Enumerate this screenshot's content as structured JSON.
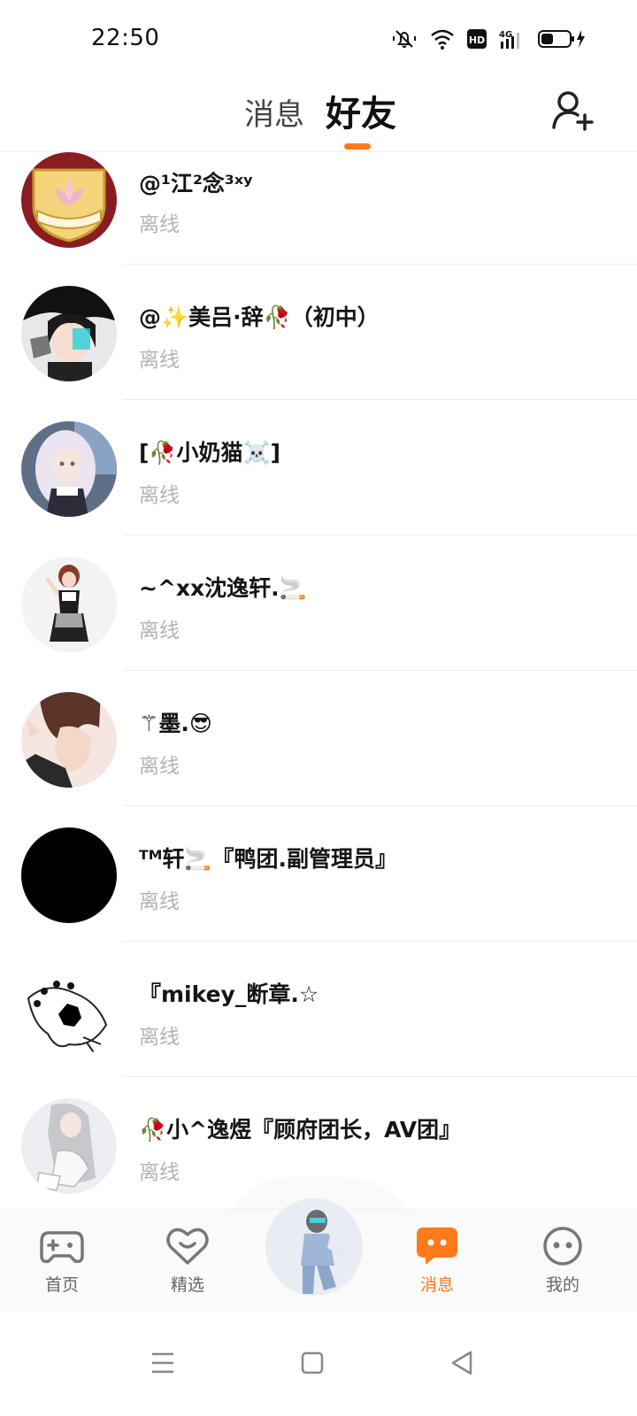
{
  "status_bar": {
    "time": "22:50",
    "hd_label": "HD",
    "network_label": "4G"
  },
  "header": {
    "tab_messages": "消息",
    "tab_friends": "好友",
    "active_tab": "好友"
  },
  "friends": [
    {
      "name": "@¹江²念³ˣʸ",
      "status": "离线"
    },
    {
      "name": "@✨美吕·辞🥀（初中）",
      "status": "离线"
    },
    {
      "name": "[🥀小奶猫☠️]",
      "status": "离线"
    },
    {
      "name": "~^xx沈逸轩.🚬",
      "status": "离线"
    },
    {
      "name": "⚚墨.😎",
      "status": "离线"
    },
    {
      "name": "ᵀᴹ轩🚬『鸭团.副管理员』",
      "status": "离线"
    },
    {
      "name": "『mikey_断章.☆",
      "status": "离线"
    },
    {
      "name": "🥀小^逸煜『顾府团长，AV团』",
      "status": "离线"
    }
  ],
  "bottom_nav": {
    "items": [
      {
        "label": "首页",
        "icon": "gamepad-icon"
      },
      {
        "label": "精选",
        "icon": "heart-icon"
      },
      {
        "label": "消息",
        "icon": "chat-icon",
        "active": true
      },
      {
        "label": "我的",
        "icon": "face-icon"
      }
    ],
    "accent_color": "#ff7a1a"
  }
}
